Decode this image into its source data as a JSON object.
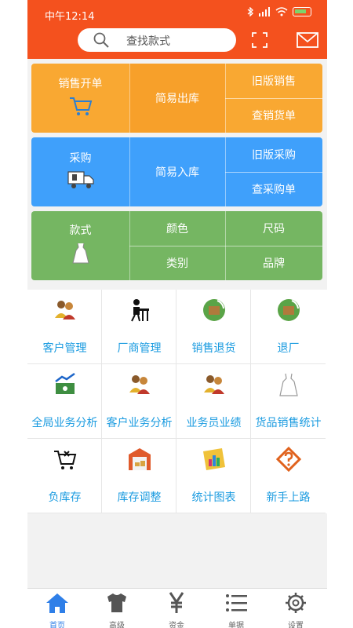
{
  "status_bar": {
    "time": "中午12:14"
  },
  "header": {
    "search_placeholder": "查找款式"
  },
  "sales_panel": {
    "left_label": "销售开单",
    "mid_label": "简易出库",
    "right_top": "旧版销售",
    "right_bottom": "查销货单",
    "color": "#f9a832"
  },
  "purchase_panel": {
    "left_label": "采购",
    "mid_label": "简易入库",
    "right_top": "旧版采购",
    "right_bottom": "查采购单",
    "color": "#3fa0fb"
  },
  "style_panel": {
    "left_label": "款式",
    "mid_top": "颜色",
    "right_top": "尺码",
    "mid_bottom": "类别",
    "right_bottom": "品牌",
    "color": "#75b662"
  },
  "grid": {
    "items": [
      {
        "label": "客户管理",
        "icon": "customers-icon"
      },
      {
        "label": "厂商管理",
        "icon": "factory-worker-icon"
      },
      {
        "label": "销售退货",
        "icon": "sales-return-icon"
      },
      {
        "label": "退厂",
        "icon": "return-factory-icon"
      },
      {
        "label": "全局业务分析",
        "icon": "global-analysis-icon"
      },
      {
        "label": "客户业务分析",
        "icon": "customer-analysis-icon"
      },
      {
        "label": "业务员业绩",
        "icon": "salesman-icon"
      },
      {
        "label": "货品销售统计",
        "icon": "dress-icon"
      },
      {
        "label": "负库存",
        "icon": "cart-x-icon"
      },
      {
        "label": "库存调整",
        "icon": "warehouse-icon"
      },
      {
        "label": "统计图表",
        "icon": "chart-icon"
      },
      {
        "label": "新手上路",
        "icon": "help-icon"
      }
    ],
    "label_color": "#1a9be0"
  },
  "bottom_nav": {
    "items": [
      {
        "label": "首页",
        "icon": "home-icon",
        "active": true
      },
      {
        "label": "高级",
        "icon": "shirt-icon"
      },
      {
        "label": "资金",
        "icon": "yen-icon"
      },
      {
        "label": "单据",
        "icon": "list-icon"
      },
      {
        "label": "设置",
        "icon": "gear-icon"
      }
    ],
    "active_color": "#2f7fe8"
  }
}
